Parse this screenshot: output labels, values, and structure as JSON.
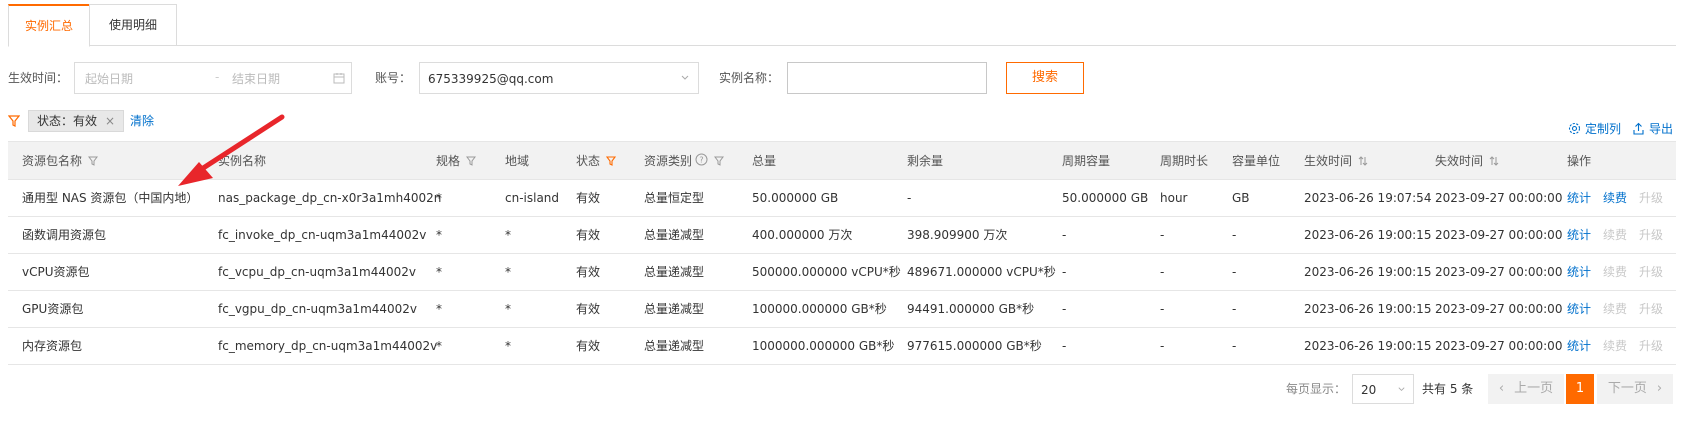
{
  "tabs": [
    {
      "label": "实例汇总",
      "active": true
    },
    {
      "label": "使用明细",
      "active": false
    }
  ],
  "filters": {
    "effective_time_label": "生效时间：",
    "start_placeholder": "起始日期",
    "separator": "-",
    "end_placeholder": "结束日期",
    "account_label": "账号：",
    "account_value": "675339925@qq.com",
    "instance_name_label": "实例名称：",
    "instance_name_value": "",
    "search_label": "搜索"
  },
  "active_filter": {
    "tag_label": "状态：有效",
    "clear_label": "清除"
  },
  "toolbar": {
    "customize_label": "定制列",
    "export_label": "导出"
  },
  "table": {
    "columns": [
      "资源包名称",
      "实例名称",
      "规格",
      "地域",
      "状态",
      "资源类别",
      "总量",
      "剩余量",
      "周期容量",
      "周期时长",
      "容量单位",
      "生效时间",
      "失效时间",
      "操作"
    ],
    "rows": [
      {
        "package": "通用型 NAS 资源包（中国内地）",
        "instance": "nas_package_dp_cn-x0r3a1mh4002n",
        "spec": "*",
        "region": "cn-island",
        "status": "有效",
        "category": "总量恒定型",
        "total": "50.000000 GB",
        "remaining": "-",
        "cycle_capacity": "50.000000 GB",
        "cycle_duration": "hour",
        "unit": "GB",
        "start": "2023-06-26 19:07:54",
        "end": "2023-09-27 00:00:00",
        "renew_enabled": true
      },
      {
        "package": "函数调用资源包",
        "instance": "fc_invoke_dp_cn-uqm3a1m44002v",
        "spec": "*",
        "region": "*",
        "status": "有效",
        "category": "总量递减型",
        "total": "400.000000 万次",
        "remaining": "398.909900 万次",
        "cycle_capacity": "-",
        "cycle_duration": "-",
        "unit": "-",
        "start": "2023-06-26 19:00:15",
        "end": "2023-09-27 00:00:00",
        "renew_enabled": false
      },
      {
        "package": "vCPU资源包",
        "instance": "fc_vcpu_dp_cn-uqm3a1m44002v",
        "spec": "*",
        "region": "*",
        "status": "有效",
        "category": "总量递减型",
        "total": "500000.000000 vCPU*秒",
        "remaining": "489671.000000 vCPU*秒",
        "cycle_capacity": "-",
        "cycle_duration": "-",
        "unit": "-",
        "start": "2023-06-26 19:00:15",
        "end": "2023-09-27 00:00:00",
        "renew_enabled": false
      },
      {
        "package": "GPU资源包",
        "instance": "fc_vgpu_dp_cn-uqm3a1m44002v",
        "spec": "*",
        "region": "*",
        "status": "有效",
        "category": "总量递减型",
        "total": "100000.000000 GB*秒",
        "remaining": "94491.000000 GB*秒",
        "cycle_capacity": "-",
        "cycle_duration": "-",
        "unit": "-",
        "start": "2023-06-26 19:00:15",
        "end": "2023-09-27 00:00:00",
        "renew_enabled": false
      },
      {
        "package": "内存资源包",
        "instance": "fc_memory_dp_cn-uqm3a1m44002v",
        "spec": "*",
        "region": "*",
        "status": "有效",
        "category": "总量递减型",
        "total": "1000000.000000 GB*秒",
        "remaining": "977615.000000 GB*秒",
        "cycle_capacity": "-",
        "cycle_duration": "-",
        "unit": "-",
        "start": "2023-06-26 19:00:15",
        "end": "2023-09-27 00:00:00",
        "renew_enabled": false
      }
    ],
    "actions": {
      "stats": "统计",
      "renew": "续费",
      "upgrade": "升级"
    }
  },
  "pagination": {
    "per_page_label": "每页显示：",
    "per_page_value": "20",
    "total_label": "共有 5 条",
    "prev_label": "上一页",
    "current_page": "1",
    "next_label": "下一页"
  },
  "colors": {
    "accent": "#ff6a00",
    "link": "#0070cc",
    "annotation_arrow": "#e8262b"
  }
}
